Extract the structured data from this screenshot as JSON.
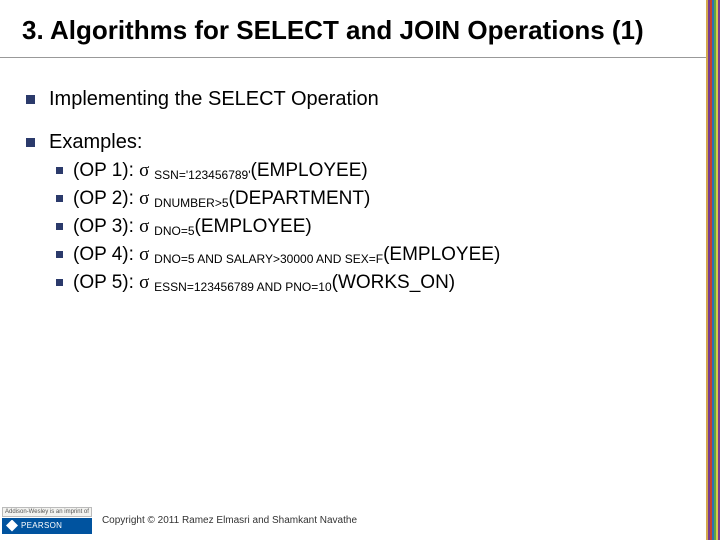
{
  "title": "3. Algorithms for SELECT and JOIN Operations (1)",
  "bullets": {
    "item1": "Implementing the SELECT Operation",
    "item2": "Examples:",
    "ex1_label": "(OP 1): ",
    "ex1_sub": "SSN='123456789'",
    "ex1_arg": "(EMPLOYEE)",
    "ex2_label": "(OP 2): ",
    "ex2_sub": "DNUMBER>5",
    "ex2_arg": "(DEPARTMENT)",
    "ex3_label": "(OP 3): ",
    "ex3_sub": "DNO=5",
    "ex3_arg": "(EMPLOYEE)",
    "ex4_label": "(OP 4): ",
    "ex4_sub": "DNO=5 AND SALARY>30000 AND SEX=F",
    "ex4_arg": "(EMPLOYEE)",
    "ex5_label": "(OP 5): ",
    "ex5_sub": "ESSN=123456789 AND PNO=10",
    "ex5_arg": "(WORKS_ON)"
  },
  "sigma": "σ ",
  "footer": {
    "aw": "Addison-Wesley\nis an imprint of",
    "pearson": "PEARSON",
    "copyright": "Copyright © 2011 Ramez Elmasri and Shamkant Navathe"
  }
}
